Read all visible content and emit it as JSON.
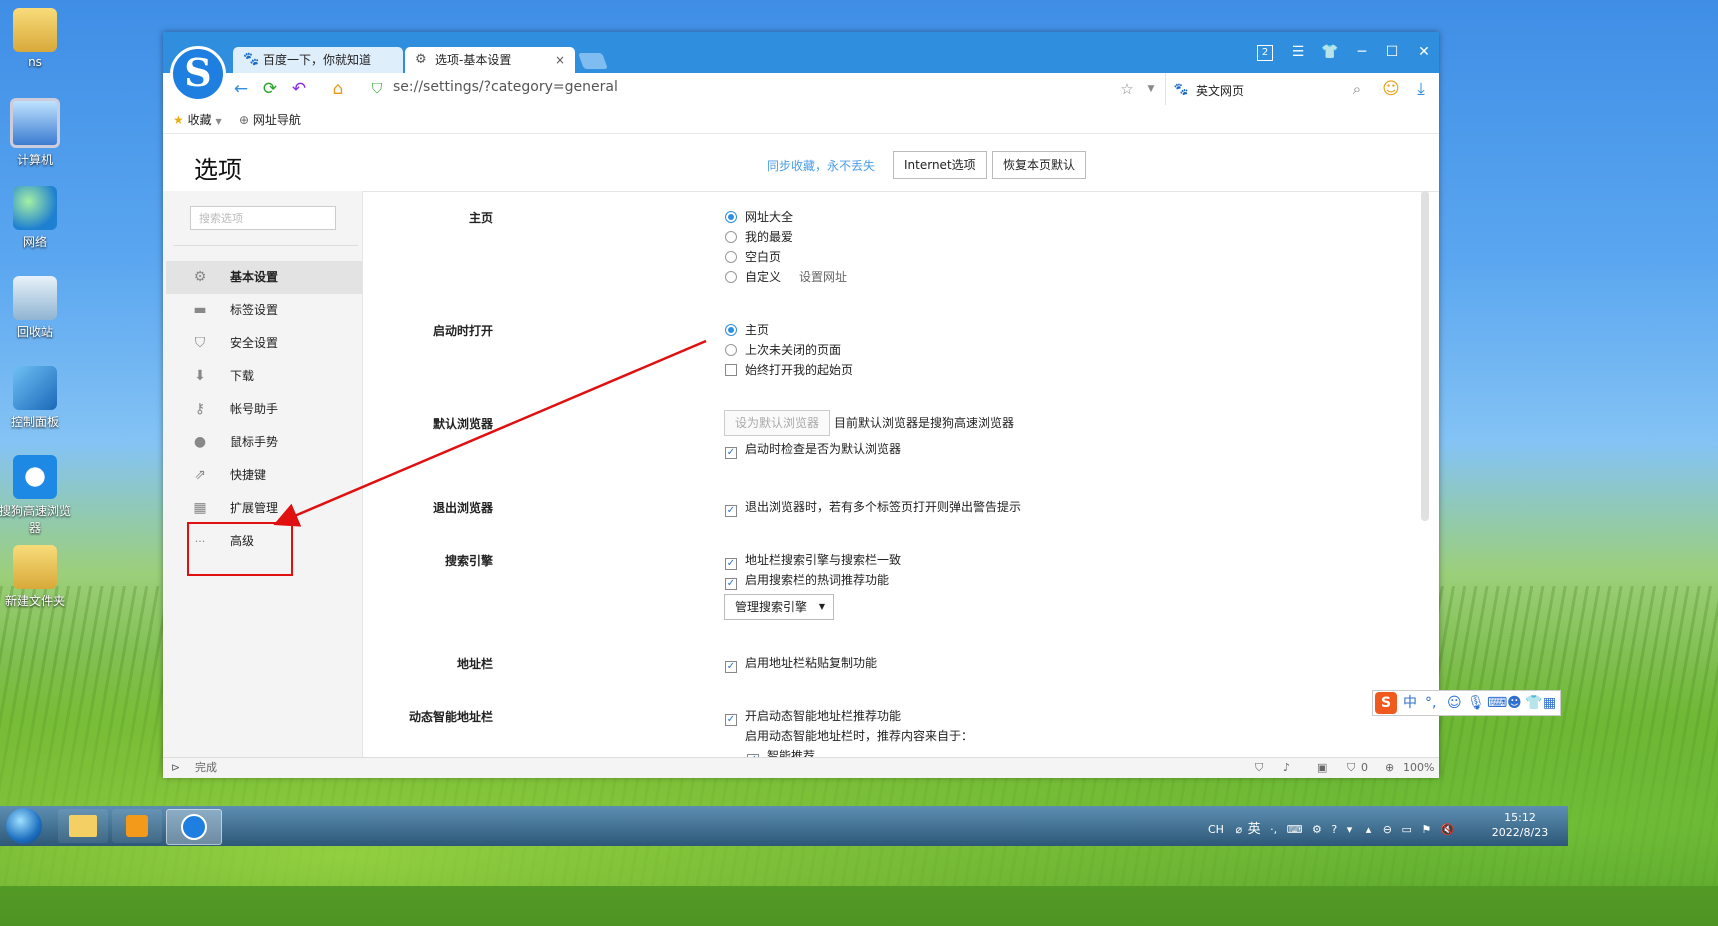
{
  "desktop": {
    "icons": [
      {
        "label": "ns"
      },
      {
        "label": "计算机"
      },
      {
        "label": "网络"
      },
      {
        "label": "回收站"
      },
      {
        "label": "控制面板"
      },
      {
        "label": "搜狗高速浏览器"
      },
      {
        "label": "新建文件夹"
      }
    ]
  },
  "browser": {
    "tabs": [
      {
        "label": "百度一下，你就知道",
        "icon": "baidu-paw-icon"
      },
      {
        "label": "选项-基本设置",
        "icon": "gear-icon"
      }
    ],
    "tab_close": "×",
    "window_badge": "2",
    "address": "se://settings/?category=general",
    "search_engine_label": "英文网页",
    "bookmarks": {
      "favorites": "收藏",
      "nav": "网址导航"
    }
  },
  "settings": {
    "title": "选项",
    "sync_link": "同步收藏，永不丢失",
    "internet_options_button": "Internet选项",
    "restore_defaults_button": "恢复本页默认",
    "search_placeholder": "搜索选项",
    "sidebar": [
      {
        "label": "基本设置",
        "icon": "gear-icon",
        "glyph": "⚙"
      },
      {
        "label": "标签设置",
        "icon": "tab-icon",
        "glyph": "▬"
      },
      {
        "label": "安全设置",
        "icon": "shield-icon",
        "glyph": "⛉"
      },
      {
        "label": "下载",
        "icon": "download-icon",
        "glyph": "⬇"
      },
      {
        "label": "帐号助手",
        "icon": "key-icon",
        "glyph": "⚷"
      },
      {
        "label": "鼠标手势",
        "icon": "mouse-icon",
        "glyph": "●"
      },
      {
        "label": "快捷键",
        "icon": "shortcut-icon",
        "glyph": "⇗"
      },
      {
        "label": "扩展管理",
        "icon": "extensions-icon",
        "glyph": "▦"
      },
      {
        "label": "高级",
        "icon": "more-icon",
        "glyph": "···"
      }
    ],
    "sections": {
      "homepage": {
        "label": "主页",
        "options": [
          "网址大全",
          "我的最爱",
          "空白页",
          "自定义"
        ],
        "selected": "网址大全",
        "set_url_link": "设置网址"
      },
      "startup": {
        "label": "启动时打开",
        "options": [
          "主页",
          "上次未关闭的页面"
        ],
        "selected": "主页",
        "always_open_start": "始终打开我的起始页"
      },
      "default_browser": {
        "label": "默认浏览器",
        "button": "设为默认浏览器",
        "status": "目前默认浏览器是搜狗高速浏览器",
        "check_on_start": "启动时检查是否为默认浏览器"
      },
      "exit_browser": {
        "label": "退出浏览器",
        "warn_multiple_tabs": "退出浏览器时，若有多个标签页打开则弹出警告提示"
      },
      "search_engine": {
        "label": "搜索引擎",
        "sync_engine": "地址栏搜索引擎与搜索栏一致",
        "hot_words": "启用搜索栏的热词推荐功能",
        "manage_button": "管理搜索引擎"
      },
      "address_bar": {
        "label": "地址栏",
        "paste_copy": "启用地址栏粘贴复制功能"
      },
      "smart_address_bar": {
        "label": "动态智能地址栏",
        "enable": "开启动态智能地址栏推荐功能",
        "hint": "启用动态智能地址栏时，推荐内容来自于：",
        "smart_recommend": "智能推荐"
      }
    },
    "statusbar": {
      "text": "完成",
      "blocked_count": "0",
      "zoom": "100%"
    }
  },
  "ime": {
    "label": "中"
  },
  "taskbar": {
    "tray_lang": "CH",
    "tray_ime": "英",
    "time": "15:12",
    "date": "2022/8/23"
  },
  "colors": {
    "accent": "#2f8fde",
    "annotation": "#e01010"
  }
}
